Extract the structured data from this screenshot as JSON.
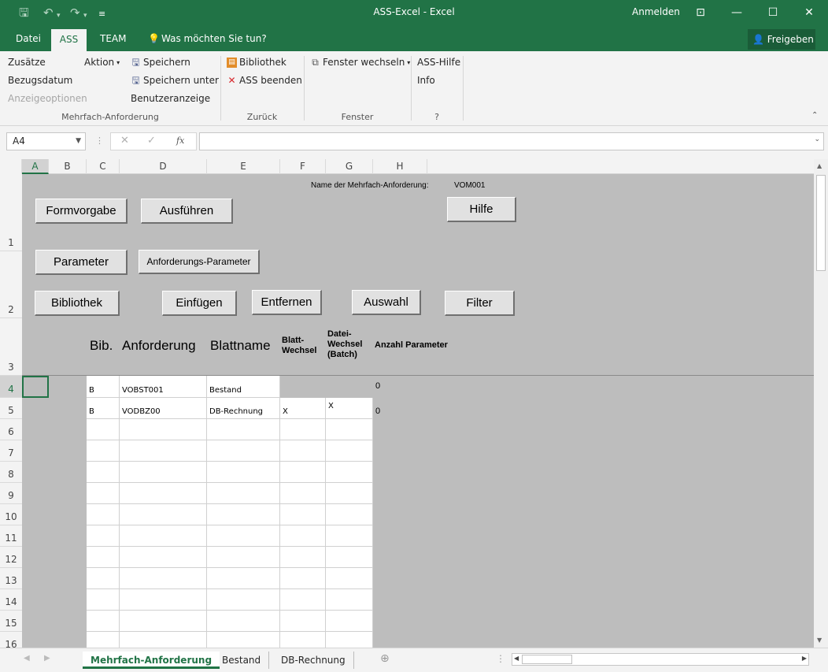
{
  "window": {
    "title": "ASS-Excel - Excel",
    "signin": "Anmelden"
  },
  "qat": {
    "save_icon": "save-icon",
    "undo_icon": "undo-icon",
    "redo_icon": "redo-icon"
  },
  "menu_tabs": {
    "file": "Datei",
    "ass": "ASS",
    "team": "TEAM",
    "search": "Was möchten Sie tun?",
    "share": "Freigeben"
  },
  "ribbon": {
    "g1": {
      "zusatze": "Zusätze",
      "aktion": "Aktion",
      "bezugsdatum": "Bezugsdatum",
      "anzeigeoptionen": "Anzeigeoptionen",
      "speichern": "Speichern",
      "speichern_unter": "Speichern unter",
      "benutzeranzeige": "Benutzeranzeige",
      "label": "Mehrfach-Anforderung"
    },
    "g2": {
      "bibliothek": "Bibliothek",
      "ass_beenden": "ASS beenden",
      "label": "Zurück"
    },
    "g3": {
      "fenster_wechseln": "Fenster wechseln",
      "label": "Fenster"
    },
    "g4": {
      "ass_hilfe": "ASS-Hilfe",
      "info": "Info",
      "label": "?"
    }
  },
  "namebox": "A4",
  "columns": [
    "A",
    "B",
    "C",
    "D",
    "E",
    "F",
    "G",
    "H"
  ],
  "rows": [
    "1",
    "2",
    "3",
    "4",
    "5",
    "6",
    "7",
    "8",
    "9",
    "10",
    "11",
    "12",
    "13",
    "14",
    "15",
    "16"
  ],
  "sheet": {
    "name_label": "Name der Mehrfach-Anforderung:",
    "name_value": "VOM001",
    "buttons": {
      "formvorgabe": "Formvorgabe",
      "ausfuehren": "Ausführen",
      "hilfe": "Hilfe",
      "parameter": "Parameter",
      "anf_parameter": "Anforderungs-Parameter",
      "bibliothek": "Bibliothek",
      "einfuegen": "Einfügen",
      "entfernen": "Entfernen",
      "auswahl": "Auswahl",
      "filter": "Filter"
    },
    "headers": {
      "bib": "Bib.",
      "anforderung": "Anforderung",
      "blattname": "Blattname",
      "blatt_wechsel_1": "Blatt-",
      "blatt_wechsel_2": "Wechsel",
      "datei_wechsel_1": "Datei-",
      "datei_wechsel_2": "Wechsel",
      "datei_wechsel_3": "(Batch)",
      "anzahl": "Anzahl Parameter"
    },
    "data_rows": [
      {
        "bib": "B",
        "anforderung": "VOBST001",
        "blattname": "Bestand",
        "blatt_wechsel": "",
        "datei_wechsel": "",
        "anzahl": "0"
      },
      {
        "bib": "B",
        "anforderung": "VODBZ00",
        "blattname": "DB-Rechnung",
        "blatt_wechsel": "X",
        "datei_wechsel": "X",
        "anzahl": "0"
      }
    ]
  },
  "sheet_tabs": [
    "Mehrfach-Anforderung",
    "Bestand",
    "DB-Rechnung"
  ]
}
